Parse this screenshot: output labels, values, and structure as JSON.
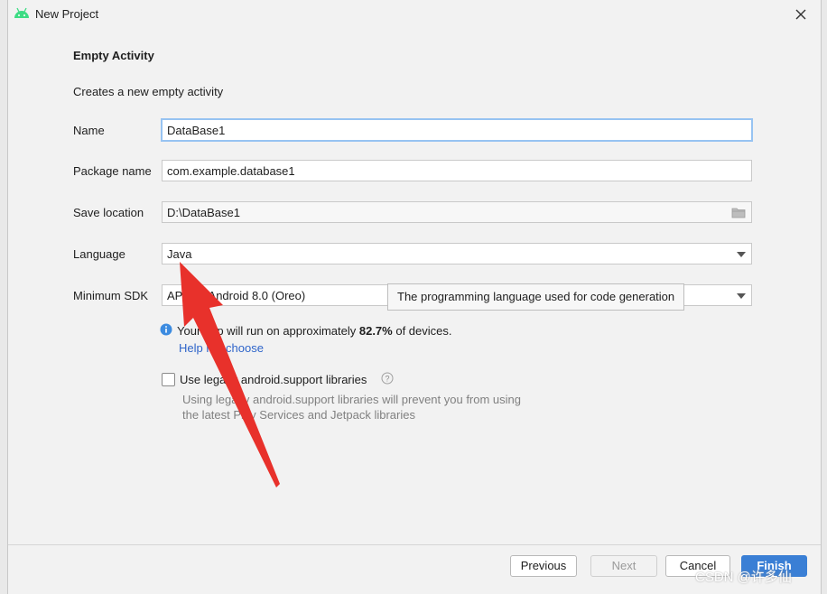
{
  "window": {
    "title": "New Project",
    "app_icon": "android-icon"
  },
  "heading": "Empty Activity",
  "subheading": "Creates a new empty activity",
  "form": {
    "name_label": "Name",
    "name_value": "DataBase1",
    "package_label": "Package name",
    "package_value": "com.example.database1",
    "location_label": "Save location",
    "location_value": "D:\\DataBase1",
    "language_label": "Language",
    "language_value": "Java",
    "min_sdk_label": "Minimum SDK",
    "min_sdk_value": "API 26: Android 8.0 (Oreo)"
  },
  "tooltip": "The programming language used for code generation",
  "info": {
    "prefix": "Your app will run on approximately ",
    "percent": "82.7%",
    "suffix": " of devices.",
    "help_link": "Help me choose"
  },
  "legacy": {
    "checked": false,
    "label": "Use legacy android.support libraries",
    "description_line1": "Using legacy android.support libraries will prevent you from using",
    "description_line2": "the latest Play Services and Jetpack libraries"
  },
  "buttons": {
    "previous": "Previous",
    "next": "Next",
    "cancel": "Cancel",
    "finish": "Finish"
  },
  "watermark": "CSDN @许多仙",
  "colors": {
    "accent": "#3a7fd5",
    "link": "#2f65ca",
    "focus_border": "#97c3f2",
    "annotation_arrow": "#e8312b",
    "android_green": "#3ddc84"
  }
}
